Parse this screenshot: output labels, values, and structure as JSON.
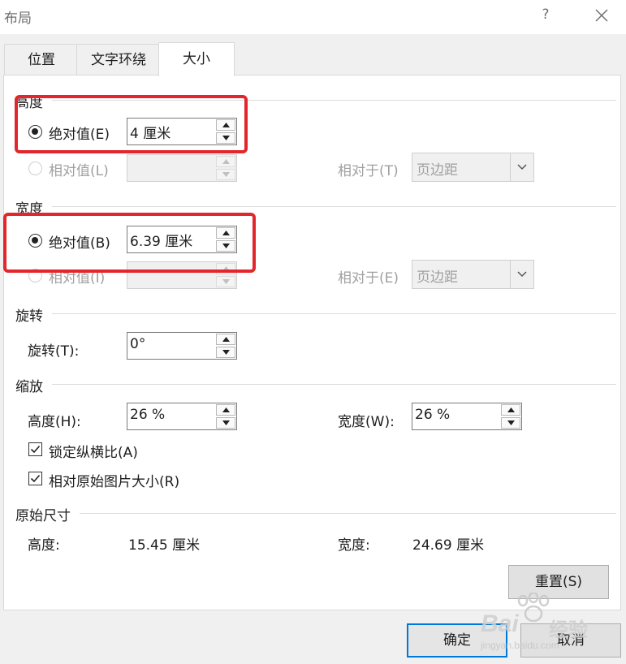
{
  "window": {
    "title": "布局",
    "help": "?"
  },
  "tabs": [
    {
      "label": "位置",
      "active": false
    },
    {
      "label": "文字环绕",
      "active": false
    },
    {
      "label": "大小",
      "active": true
    }
  ],
  "height_section": {
    "label": "高度",
    "absolute": {
      "label": "绝对值(E)",
      "value": "4 厘米",
      "checked": true
    },
    "relative": {
      "label": "相对值(L)",
      "value": "",
      "checked": false,
      "relative_to_label": "相对于(T)",
      "relative_to_value": "页边距"
    }
  },
  "width_section": {
    "label": "宽度",
    "absolute": {
      "label": "绝对值(B)",
      "value": "6.39 厘米",
      "checked": true
    },
    "relative": {
      "label": "相对值(I)",
      "value": "",
      "checked": false,
      "relative_to_label": "相对于(E)",
      "relative_to_value": "页边距"
    }
  },
  "rotation_section": {
    "label": "旋转",
    "field_label": "旋转(T):",
    "value": "0°"
  },
  "scale_section": {
    "label": "缩放",
    "height_label": "高度(H):",
    "height_value": "26 %",
    "width_label": "宽度(W):",
    "width_value": "26 %",
    "lock_aspect": {
      "label": "锁定纵横比(A)",
      "checked": true
    },
    "relative_original": {
      "label": "相对原始图片大小(R)",
      "checked": true
    }
  },
  "original_section": {
    "label": "原始尺寸",
    "height_label": "高度:",
    "height_value": "15.45 厘米",
    "width_label": "宽度:",
    "width_value": "24.69 厘米"
  },
  "buttons": {
    "reset": "重置(S)",
    "ok": "确定",
    "cancel": "取消"
  },
  "watermark": {
    "brand": "Bai",
    "brand_suffix": "经验",
    "url": "jingyan.baidu.com"
  },
  "colors": {
    "highlight": "#e3262b",
    "default_button_border": "#0078d7"
  }
}
